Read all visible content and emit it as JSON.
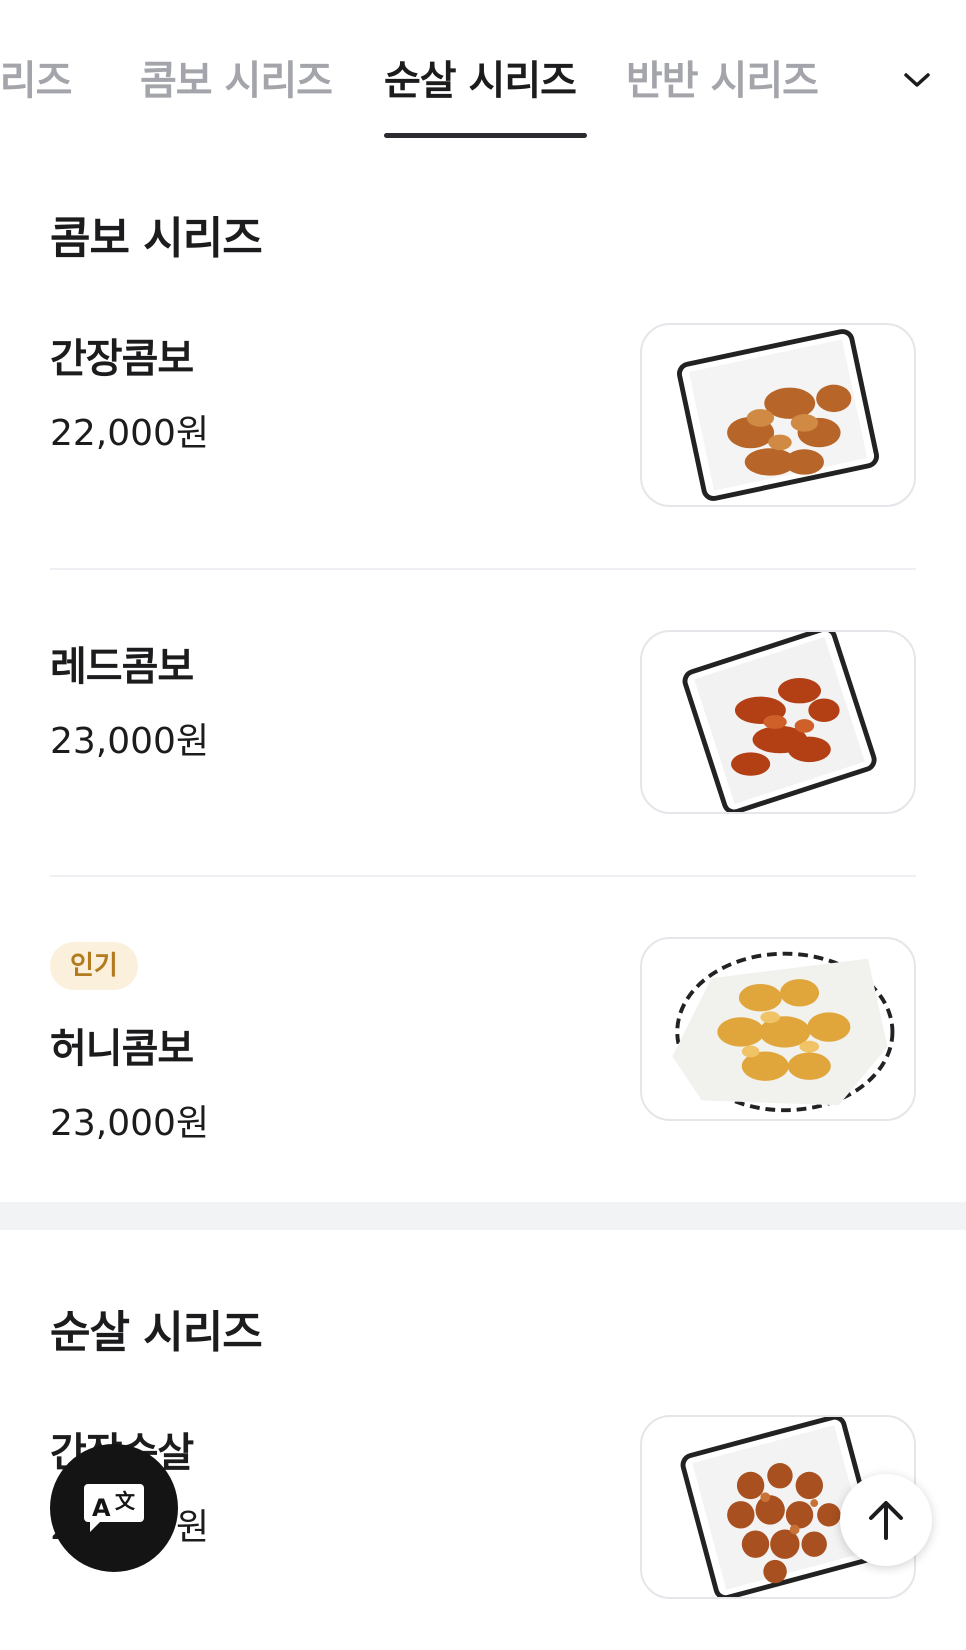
{
  "tabs": [
    {
      "label": "시리즈",
      "active": false
    },
    {
      "label": "콤보 시리즈",
      "active": false
    },
    {
      "label": "순살 시리즈",
      "active": true
    },
    {
      "label": "반반 시리즈",
      "active": false
    }
  ],
  "dropdown_icon": "chevron-down-icon",
  "sections": [
    {
      "title": "콤보 시리즈",
      "items": [
        {
          "name": "간장콤보",
          "price": "22,000원",
          "badge": ""
        },
        {
          "name": "레드콤보",
          "price": "23,000원",
          "badge": ""
        },
        {
          "name": "허니콤보",
          "price": "23,000원",
          "badge": "인기"
        }
      ]
    },
    {
      "title": "순살 시리즈",
      "items": [
        {
          "name": "간장순살",
          "price": "22,000원",
          "badge": ""
        }
      ]
    }
  ],
  "floating": {
    "translate_icon": "translate-icon",
    "scroll_top_icon": "arrow-up-icon"
  },
  "colors": {
    "active_tab": "#1c1c1e",
    "inactive_tab": "#a3a5ab",
    "badge_bg": "#fbf0dc",
    "badge_text": "#b27b20"
  }
}
